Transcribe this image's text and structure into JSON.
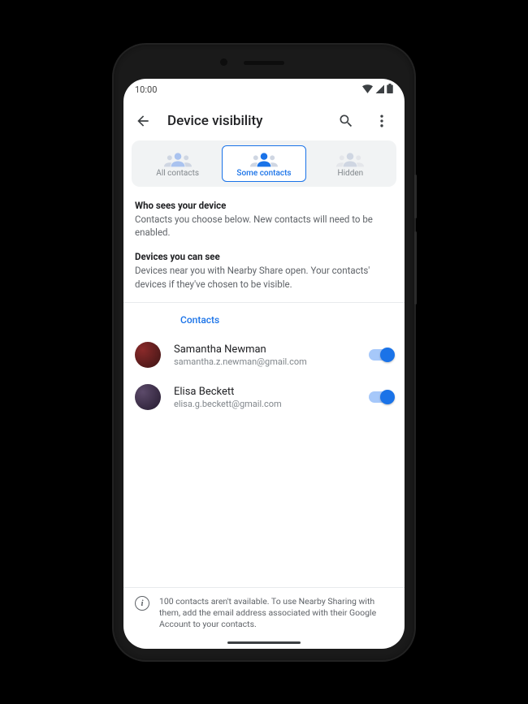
{
  "statusbar": {
    "time": "10:00"
  },
  "header": {
    "title": "Device visibility"
  },
  "tabs": {
    "all": "All contacts",
    "some": "Some contacts",
    "hidden": "Hidden"
  },
  "sections": {
    "who_h": "Who sees your device",
    "who_p": "Contacts you choose below. New contacts will need to be enabled.",
    "dev_h": "Devices you can see",
    "dev_p": "Devices near you with Nearby Share open. Your contacts' devices if they've chosen to be visible."
  },
  "contacts_label": "Contacts",
  "contacts": [
    {
      "name": "Samantha Newman",
      "email": "samantha.z.newman@gmail.com"
    },
    {
      "name": "Elisa Beckett",
      "email": "elisa.g.beckett@gmail.com"
    }
  ],
  "footer": {
    "text": "100 contacts aren't available. To use Nearby Sharing with them, add the email address associated with their Google Account to your contacts."
  }
}
